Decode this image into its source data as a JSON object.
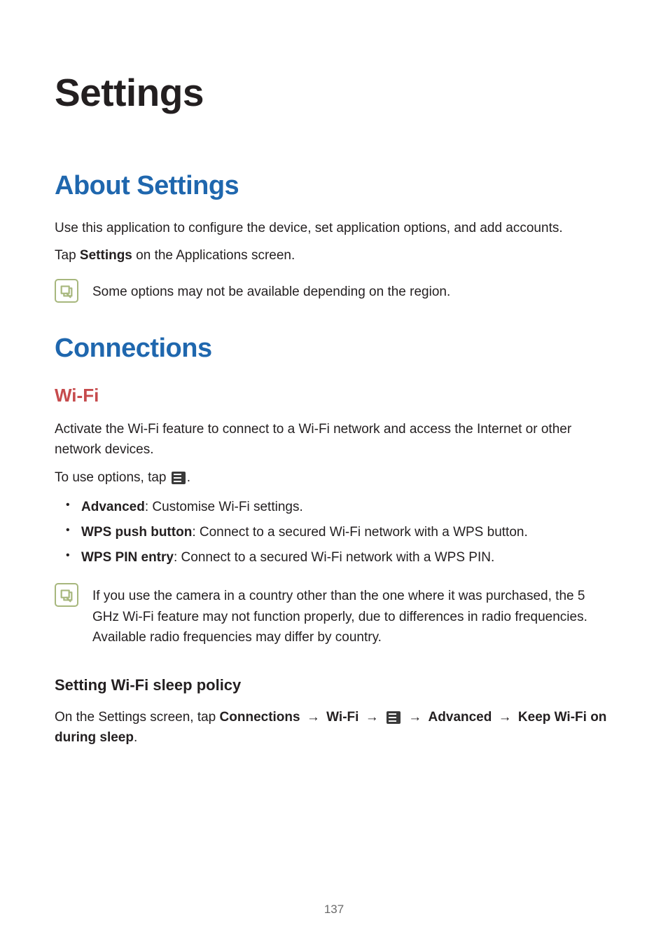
{
  "title": "Settings",
  "about": {
    "heading": "About Settings",
    "p1": "Use this application to configure the device, set application options, and add accounts.",
    "p2_pre": "Tap ",
    "p2_bold": "Settings",
    "p2_post": " on the Applications screen.",
    "note": "Some options may not be available depending on the region."
  },
  "connections": {
    "heading": "Connections",
    "wifi": {
      "heading": "Wi-Fi",
      "p1": "Activate the Wi-Fi feature to connect to a Wi-Fi network and access the Internet or other network devices.",
      "p2_pre": "To use options, tap ",
      "p2_post": ".",
      "bullets": [
        {
          "label": "Advanced",
          "desc": ": Customise Wi-Fi settings."
        },
        {
          "label": "WPS push button",
          "desc": ": Connect to a secured Wi-Fi network with a WPS button."
        },
        {
          "label": "WPS PIN entry",
          "desc": ": Connect to a secured Wi-Fi network with a WPS PIN."
        }
      ],
      "note": "If you use the camera in a country other than the one where it was purchased, the 5 GHz Wi-Fi feature may not function properly, due to differences in radio frequencies. Available radio frequencies may differ by country.",
      "sleep": {
        "heading": "Setting Wi-Fi sleep policy",
        "p_pre": "On the Settings screen, tap ",
        "path1": "Connections",
        "arrow": "→",
        "path2": "Wi-Fi",
        "path3": "Advanced",
        "path4": "Keep Wi-Fi on during sleep",
        "period": "."
      }
    }
  },
  "page_number": "137"
}
